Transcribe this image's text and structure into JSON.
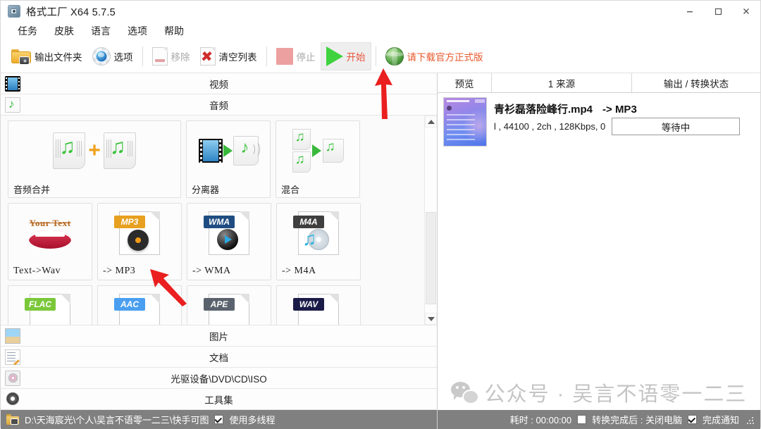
{
  "window": {
    "title": "格式工厂 X64 5.7.5",
    "icon": "app-icon",
    "controls": {
      "minimize": "–",
      "maximize": "❐",
      "close": "✕"
    }
  },
  "menu": {
    "items": [
      {
        "label": "任务"
      },
      {
        "label": "皮肤"
      },
      {
        "label": "语言"
      },
      {
        "label": "选项"
      },
      {
        "label": "帮助"
      }
    ]
  },
  "toolbar": {
    "output_folder": "输出文件夹",
    "options": "选项",
    "remove": "移除",
    "clear_list": "清空列表",
    "stop": "停止",
    "start": "开始",
    "promo": "请下载官方正式版"
  },
  "categories": {
    "video": "视频",
    "audio": "音频",
    "picture": "图片",
    "document": "文档",
    "optical": "光驱设备\\DVD\\CD\\ISO",
    "toolset": "工具集"
  },
  "tiles": [
    {
      "label": "音频合并",
      "kind": "merge",
      "wide": true
    },
    {
      "label": "分离器",
      "kind": "demux"
    },
    {
      "label": "混合",
      "kind": "mix"
    },
    {
      "label": "Text->Wav",
      "kind": "text2wav",
      "mono": true
    },
    {
      "label": "-> MP3",
      "kind": "file",
      "badge": "MP3",
      "badge_color": "#e8a020",
      "mono": true
    },
    {
      "label": "-> WMA",
      "kind": "file",
      "badge": "WMA",
      "badge_color": "#1f4d82",
      "mono": true
    },
    {
      "label": "-> M4A",
      "kind": "file",
      "badge": "M4A",
      "badge_color": "#3f3f3f",
      "mono": true
    },
    {
      "label": "",
      "kind": "file",
      "badge": "FLAC",
      "badge_color": "#7ac83a",
      "mono": true
    },
    {
      "label": "",
      "kind": "file",
      "badge": "AAC",
      "badge_color": "#4a9ff0",
      "mono": true
    },
    {
      "label": "",
      "kind": "file",
      "badge": "APE",
      "badge_color": "#5a636d",
      "mono": true
    },
    {
      "label": "",
      "kind": "file",
      "badge": "WAV",
      "badge_color": "#1b1b48",
      "mono": true
    }
  ],
  "left_status": {
    "path": "D:\\天海宸光\\个人\\吴言不语零一二三\\快手可图",
    "multithread_label": "使用多线程",
    "multithread_checked": true
  },
  "right_panel": {
    "columns": {
      "preview": "预览",
      "source": "1 来源",
      "output": "输出 / 转换状态"
    },
    "item": {
      "name": "青衫磊落险峰行.mp4",
      "target": "-> MP3",
      "meta": "l , 44100 , 2ch , 128Kbps, 0",
      "status": "等待中"
    },
    "watermark": "公众号 · 吴言不语零一二三"
  },
  "right_status": {
    "elapsed": "耗时 : 00:00:00",
    "shutdown_label": "转换完成后 : 关闭电脑",
    "shutdown_checked": false,
    "notify_label": "完成通知",
    "notify_checked": true
  },
  "colors": {
    "start_green": "#3fd23f",
    "promo_orange": "#e8582c",
    "status_bar_gray": "#808080",
    "annotation_red": "#ea1f1f"
  }
}
